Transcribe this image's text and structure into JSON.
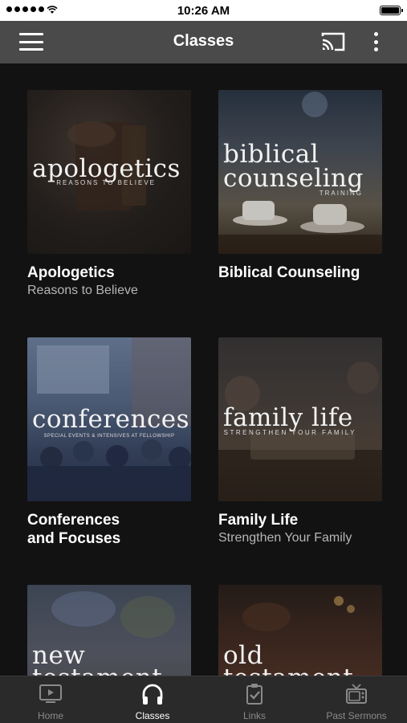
{
  "status_bar": {
    "time": "10:26 AM",
    "battery_level": 1.0
  },
  "header": {
    "title": "Classes",
    "menu_icon": "hamburger-menu-icon",
    "cast_icon": "cast-icon",
    "more_icon": "more-vertical-icon"
  },
  "classes": [
    {
      "title": "Apologetics",
      "subtitle": "Reasons to Believe",
      "art_title": "apologetics",
      "art_tagline": "REASONS TO BELIEVE",
      "colors": [
        "#2d2824",
        "#3a3330"
      ]
    },
    {
      "title": "Biblical Counseling",
      "subtitle": "",
      "art_title_line1": "biblical",
      "art_title_line2": "counseling",
      "art_tagline": "TRAINING",
      "colors": [
        "#3a4350",
        "#7d7462"
      ]
    },
    {
      "title_line1": "Conferences",
      "title_line2": "and Focuses",
      "art_title": "conferences",
      "art_tagline": "SPECIAL EVENTS & INTENSIVES AT FELLOWSHIP",
      "colors": [
        "#5a6e8c",
        "#3b4a66"
      ]
    },
    {
      "title": "Family Life",
      "subtitle": "Strengthen Your Family",
      "art_title": "family life",
      "art_tagline": "STRENGTHEN YOUR FAMILY",
      "colors": [
        "#3b3531",
        "#5c4f45"
      ]
    },
    {
      "art_title_line1": "new",
      "art_title_line2": "testament",
      "colors": [
        "#3f4a5a",
        "#5a5a5a"
      ]
    },
    {
      "art_title_line1": "old",
      "art_title_line2": "testament",
      "colors": [
        "#3a2e28",
        "#6a4a3a"
      ]
    }
  ],
  "tabs": [
    {
      "label": "Home",
      "icon": "tv-play-icon",
      "active": false
    },
    {
      "label": "Classes",
      "icon": "headphones-icon",
      "active": true
    },
    {
      "label": "Links",
      "icon": "clipboard-check-icon",
      "active": false
    },
    {
      "label": "Past Sermons",
      "icon": "retro-tv-icon",
      "active": false
    }
  ]
}
